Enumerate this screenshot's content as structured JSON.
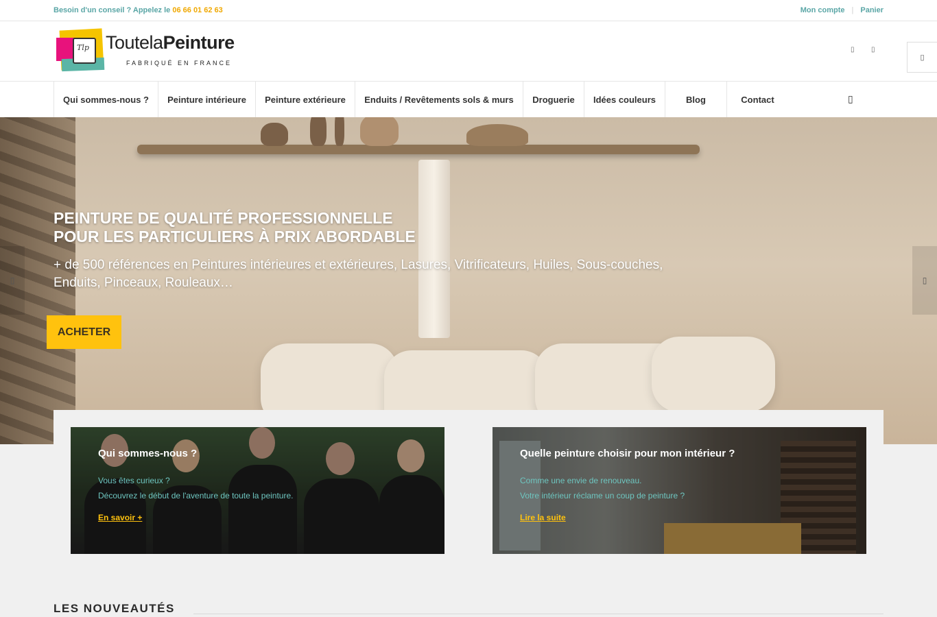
{
  "topbar": {
    "advice": "Besoin d'un conseil ? Appelez le ",
    "phone": "06 66 01 62 63",
    "account": "Mon compte",
    "cart": "Panier"
  },
  "header": {
    "logo_name_light": "Toutela",
    "logo_name_bold": "Peinture",
    "logo_tagline": "FABRIQUÉ EN FRANCE",
    "logo_badge": "Tlp",
    "icons": [
      "social-icon",
      "social-icon",
      "cart-icon"
    ]
  },
  "nav": {
    "items": [
      "Qui sommes-nous ?",
      "Peinture intérieure",
      "Peinture extérieure",
      "Enduits / Revêtements sols & murs",
      "Droguerie",
      "Idées couleurs",
      "Blog",
      "Contact"
    ],
    "search_icon": "search-icon"
  },
  "hero": {
    "title_line1": "PEINTURE DE QUALITÉ PROFESSIONNELLE",
    "title_line2": "POUR LES PARTICULIERS À PRIX ABORDABLE",
    "subtitle": "+ de 500 références en Peintures intérieures et extérieures, Lasures, Vitrificateurs, Huiles, Sous-couches, Enduits, Pinceaux, Rouleaux…",
    "cta": "ACHETER",
    "cta_color": "#ffc20e"
  },
  "cards": [
    {
      "title": "Qui sommes-nous ?",
      "line1": "Vous êtes curieux ?",
      "line2": "Découvrez le début de l'aventure de toute la peinture.",
      "link": "En savoir +"
    },
    {
      "title": "Quelle peinture choisir pour mon intérieur ?",
      "line1": "Comme une envie de renouveau.",
      "line2": "Votre intérieur réclame un coup de peinture ?",
      "link": "Lire la suite"
    }
  ],
  "section": {
    "title": "LES NOUVEAUTÉS"
  }
}
